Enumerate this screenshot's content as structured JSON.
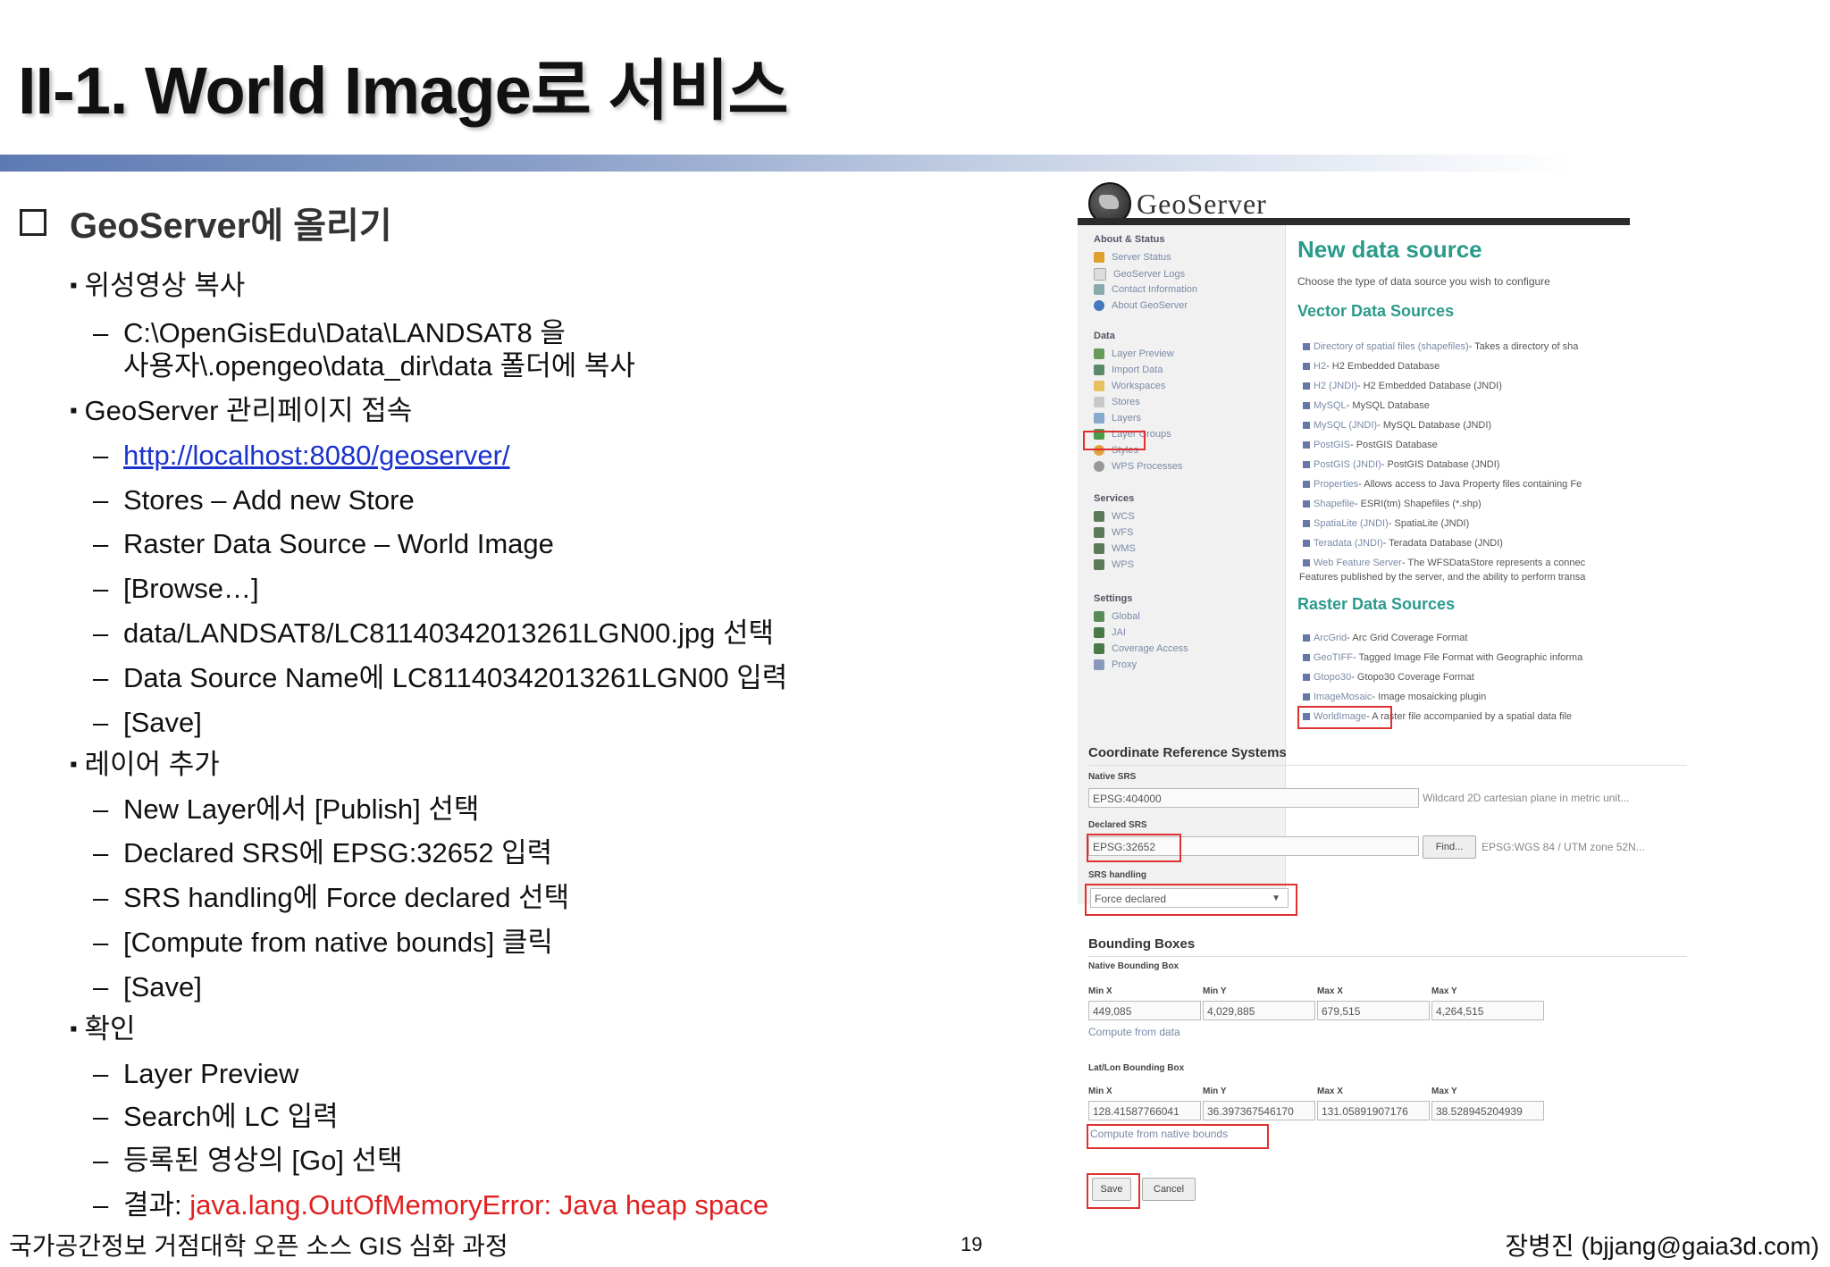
{
  "slide": {
    "title": "II-1. World Image로 서비스",
    "section": "GeoServer에 올리기",
    "lines": [
      {
        "kind": "bullet",
        "text": "위성영상 복사"
      },
      {
        "kind": "sub",
        "text": "C:\\OpenGisEdu\\Data\\LANDSAT8 을"
      },
      {
        "kind": "cont",
        "text": "사용자\\.opengeo\\data_dir\\data 폴더에 복사"
      },
      {
        "kind": "bullet",
        "text": "GeoServer 관리페이지 접속"
      },
      {
        "kind": "sub",
        "text": "http://localhost:8080/geoserver/"
      },
      {
        "kind": "sub",
        "text": "Stores – Add new Store"
      },
      {
        "kind": "sub",
        "text": "Raster Data Source – World Image"
      },
      {
        "kind": "sub",
        "text": "[Browse…]"
      },
      {
        "kind": "sub",
        "text": "data/LANDSAT8/LC81140342013261LGN00.jpg 선택"
      },
      {
        "kind": "sub",
        "text": "Data Source Name에 LC81140342013261LGN00 입력"
      },
      {
        "kind": "sub",
        "text": "[Save]"
      },
      {
        "kind": "bullet",
        "text": "레이어 추가"
      },
      {
        "kind": "sub",
        "text": "New Layer에서 [Publish] 선택"
      },
      {
        "kind": "sub",
        "text": "Declared SRS에 EPSG:32652 입력"
      },
      {
        "kind": "sub",
        "text": "SRS handling에 Force declared 선택"
      },
      {
        "kind": "sub",
        "text": "[Compute from native bounds] 클릭"
      },
      {
        "kind": "sub",
        "text": "[Save]"
      },
      {
        "kind": "bullet",
        "text": "확인"
      },
      {
        "kind": "sub",
        "text": "Layer Preview"
      },
      {
        "kind": "sub",
        "text": "Search에 LC 입력"
      },
      {
        "kind": "sub",
        "text": "등록된 영상의 [Go] 선택"
      }
    ],
    "result_label": "결과: ",
    "result_error": "java.lang.OutOfMemoryError: Java heap space",
    "link_color": "#1a33cc",
    "error_color": "#e02020"
  },
  "footer": {
    "course": "국가공간정보 거점대학 오픈 소스 GIS 심화 과정",
    "page": "19",
    "author": "장병진 (bjjang@gaia3d.com)"
  },
  "geoserver": {
    "logo": "GeoServer",
    "sidebar": {
      "about_heading": "About & Status",
      "about_items": [
        "Server Status",
        "GeoServer Logs",
        "Contact Information",
        "About GeoServer"
      ],
      "data_heading": "Data",
      "data_items": [
        "Layer Preview",
        "Import Data",
        "Workspaces",
        "Stores",
        "Layers",
        "Layer Groups",
        "Styles",
        "WPS Processes"
      ],
      "services_heading": "Services",
      "services_items": [
        "WCS",
        "WFS",
        "WMS",
        "WPS"
      ],
      "settings_heading": "Settings",
      "settings_items": [
        "Global",
        "JAI",
        "Coverage Access",
        "Proxy"
      ]
    },
    "page_title": "New data source",
    "page_desc": "Choose the type of data source you wish to configure",
    "vector_heading": "Vector Data Sources",
    "vector_sources": [
      {
        "name": "Directory of spatial files (shapefiles)",
        "desc": " - Takes a directory of sha"
      },
      {
        "name": "H2",
        "desc": " - H2 Embedded Database"
      },
      {
        "name": "H2 (JNDI)",
        "desc": " - H2 Embedded Database (JNDI)"
      },
      {
        "name": "MySQL",
        "desc": " - MySQL Database"
      },
      {
        "name": "MySQL (JNDI)",
        "desc": " - MySQL Database (JNDI)"
      },
      {
        "name": "PostGIS",
        "desc": " - PostGIS Database"
      },
      {
        "name": "PostGIS (JNDI)",
        "desc": " - PostGIS Database (JNDI)"
      },
      {
        "name": "Properties",
        "desc": " - Allows access to Java Property files containing Fe"
      },
      {
        "name": "Shapefile",
        "desc": " - ESRI(tm) Shapefiles (*.shp)"
      },
      {
        "name": "SpatiaLite (JNDI)",
        "desc": " - SpatiaLite (JNDI)"
      },
      {
        "name": "Teradata (JNDI)",
        "desc": " - Teradata Database (JNDI)"
      },
      {
        "name": "Web Feature Server",
        "desc": " - The WFSDataStore represents a connec"
      }
    ],
    "vector_wrap": "Features published by the server, and the ability to perform transa",
    "raster_heading": "Raster Data Sources",
    "raster_sources": [
      {
        "name": "ArcGrid",
        "desc": " - Arc Grid Coverage Format"
      },
      {
        "name": "GeoTIFF",
        "desc": " - Tagged Image File Format with Geographic informa"
      },
      {
        "name": "Gtopo30",
        "desc": " - Gtopo30 Coverage Format"
      },
      {
        "name": "ImageMosaic",
        "desc": " - Image mosaicking plugin"
      },
      {
        "name": "WorldImage",
        "desc": " - A raster file accompanied by a spatial data file"
      }
    ],
    "crs": {
      "heading": "Coordinate Reference Systems",
      "native_label": "Native SRS",
      "native_value": "EPSG:404000",
      "native_note": "Wildcard 2D cartesian plane in metric unit...",
      "declared_label": "Declared SRS",
      "declared_value": "EPSG:32652",
      "find_label": "Find...",
      "declared_note": "EPSG:WGS 84 / UTM zone 52N...",
      "handling_label": "SRS handling",
      "handling_value": "Force declared"
    },
    "bbox": {
      "heading": "Bounding Boxes",
      "native_label": "Native Bounding Box",
      "cols": [
        "Min X",
        "Min Y",
        "Max X",
        "Max Y"
      ],
      "native_values": [
        "449,085",
        "4,029,885",
        "679,515",
        "4,264,515"
      ],
      "compute_data": "Compute from data",
      "latlon_label": "Lat/Lon Bounding Box",
      "latlon_values": [
        "128.41587766041",
        "36.397367546170",
        "131.05891907176",
        "38.528945204939"
      ],
      "compute_native": "Compute from native bounds"
    },
    "save_label": "Save",
    "cancel_label": "Cancel",
    "accent_color": "#2a9a8a",
    "highlight_color": "#e03030"
  }
}
